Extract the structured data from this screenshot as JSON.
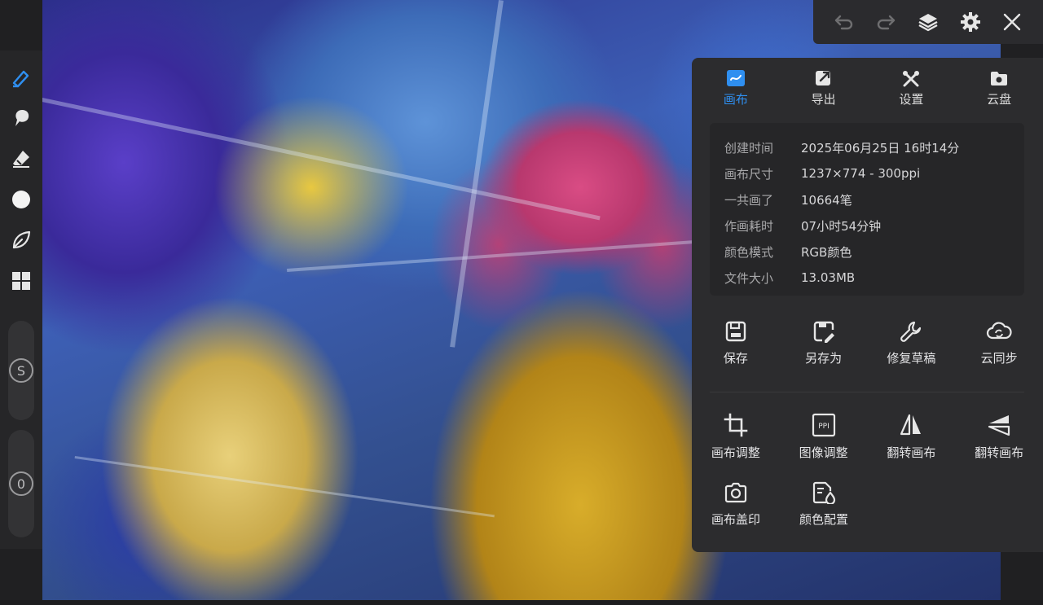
{
  "topbar": {
    "icons": [
      "undo-icon",
      "redo-icon",
      "layers-icon",
      "gear-icon",
      "close-icon"
    ]
  },
  "toolbar": {
    "tools": [
      "pen-icon",
      "smudge-icon",
      "eraser-icon",
      "color-circle-icon",
      "leaf-icon",
      "grid-icon"
    ],
    "size_slider_label": "S",
    "opacity_slider_label": "0"
  },
  "panel": {
    "tabs": [
      {
        "label": "画布",
        "icon": "canvas-icon",
        "active": true
      },
      {
        "label": "导出",
        "icon": "export-icon",
        "active": false
      },
      {
        "label": "设置",
        "icon": "tools-icon",
        "active": false
      },
      {
        "label": "云盘",
        "icon": "cloud-folder-icon",
        "active": false
      }
    ],
    "info": [
      {
        "key": "创建时间",
        "value": "2025年06月25日 16时14分"
      },
      {
        "key": "画布尺寸",
        "value": "1237×774 - 300ppi"
      },
      {
        "key": "一共画了",
        "value": "10664笔"
      },
      {
        "key": "作画耗时",
        "value": "07小时54分钟"
      },
      {
        "key": "颜色模式",
        "value": "RGB颜色"
      },
      {
        "key": "文件大小",
        "value": "13.03MB"
      }
    ],
    "actions_row1": [
      {
        "label": "保存",
        "icon": "save-icon"
      },
      {
        "label": "另存为",
        "icon": "save-as-icon"
      },
      {
        "label": "修复草稿",
        "icon": "wrench-icon"
      },
      {
        "label": "云同步",
        "icon": "cloud-sync-icon"
      }
    ],
    "actions_row2": [
      {
        "label": "画布调整",
        "icon": "crop-icon"
      },
      {
        "label": "图像调整",
        "icon": "ppi-icon",
        "icon_text": "PPI"
      },
      {
        "label": "翻转画布",
        "icon": "flip-horizontal-icon"
      },
      {
        "label": "翻转画布",
        "icon": "flip-vertical-icon"
      }
    ],
    "actions_row3": [
      {
        "label": "画布盖印",
        "icon": "camera-icon"
      },
      {
        "label": "颜色配置",
        "icon": "color-profile-icon"
      }
    ]
  },
  "colors": {
    "accent": "#2f8ff0",
    "panel_bg": "#2c2c2e",
    "toolbar_bg": "#262628"
  }
}
